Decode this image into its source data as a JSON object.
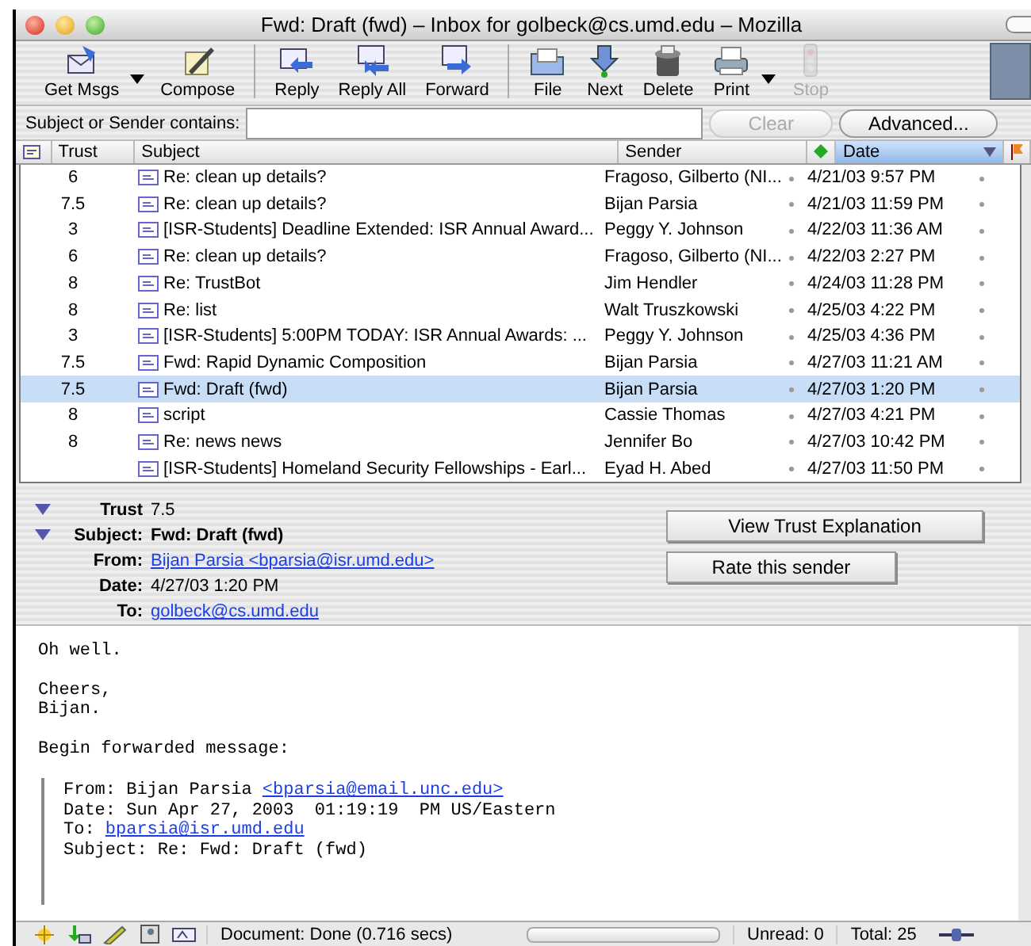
{
  "window": {
    "title": "Fwd: Draft (fwd) – Inbox for golbeck@cs.umd.edu – Mozilla"
  },
  "toolbar": [
    [
      {
        "label": "Get Msgs",
        "kind": "getmsgs",
        "menu": true,
        "disabled": false
      },
      {
        "label": "Compose",
        "kind": "compose",
        "menu": false,
        "disabled": false
      }
    ],
    [
      {
        "label": "Reply",
        "kind": "reply",
        "menu": false,
        "disabled": false
      },
      {
        "label": "Reply All",
        "kind": "replyall",
        "menu": false,
        "disabled": false
      },
      {
        "label": "Forward",
        "kind": "forward",
        "menu": false,
        "disabled": false
      }
    ],
    [
      {
        "label": "File",
        "kind": "file",
        "menu": false,
        "disabled": false
      },
      {
        "label": "Next",
        "kind": "next",
        "menu": false,
        "disabled": false
      },
      {
        "label": "Delete",
        "kind": "delete",
        "menu": false,
        "disabled": false
      },
      {
        "label": "Print",
        "kind": "print",
        "menu": true,
        "disabled": false
      },
      {
        "label": "Stop",
        "kind": "stop",
        "menu": false,
        "disabled": true
      }
    ]
  ],
  "search": {
    "label": "Subject or Sender contains:",
    "clear": {
      "label": "Clear",
      "disabled": true
    },
    "advanced": {
      "label": "Advanced..."
    }
  },
  "columns": {
    "trust": "Trust",
    "subject": "Subject",
    "sender": "Sender",
    "date": "Date"
  },
  "rows": [
    {
      "trust": "6",
      "subject": "Re: clean up details?",
      "sender": "Fragoso, Gilberto (NI...",
      "date": "4/21/03 9:57 PM",
      "selected": false
    },
    {
      "trust": "7.5",
      "subject": "Re: clean up details?",
      "sender": "Bijan Parsia",
      "date": "4/21/03 11:59 PM",
      "selected": false
    },
    {
      "trust": "3",
      "subject": "[ISR-Students] Deadline Extended: ISR Annual Award...",
      "sender": "Peggy Y. Johnson",
      "date": "4/22/03 11:36 AM",
      "selected": false
    },
    {
      "trust": "6",
      "subject": "Re: clean up details?",
      "sender": "Fragoso, Gilberto (NI...",
      "date": "4/22/03 2:27 PM",
      "selected": false
    },
    {
      "trust": "8",
      "subject": "Re: TrustBot",
      "sender": "Jim Hendler",
      "date": "4/24/03 11:28 PM",
      "selected": false
    },
    {
      "trust": "8",
      "subject": "Re: list",
      "sender": "Walt Truszkowski",
      "date": "4/25/03 4:22 PM",
      "selected": false
    },
    {
      "trust": "3",
      "subject": "[ISR-Students] 5:00PM TODAY: ISR Annual Awards: ...",
      "sender": "Peggy Y. Johnson",
      "date": "4/25/03 4:36 PM",
      "selected": false
    },
    {
      "trust": "7.5",
      "subject": "Fwd: Rapid Dynamic Composition",
      "sender": "Bijan Parsia",
      "date": "4/27/03 11:21 AM",
      "selected": false
    },
    {
      "trust": "7.5",
      "subject": "Fwd: Draft (fwd)",
      "sender": "Bijan Parsia",
      "date": "4/27/03 1:20 PM",
      "selected": true
    },
    {
      "trust": "8",
      "subject": "script",
      "sender": "Cassie Thomas",
      "date": "4/27/03 4:21 PM",
      "selected": false
    },
    {
      "trust": "8",
      "subject": "Re: news news",
      "sender": "Jennifer Bo",
      "date": "4/27/03 10:42 PM",
      "selected": false
    },
    {
      "subject": "[ISR-Students] Homeland Security Fellowships - Earl...",
      "sender": "Eyad H. Abed",
      "date": "4/27/03 11:50 PM",
      "selected": false
    }
  ],
  "header": {
    "fields": [
      {
        "label": "Trust",
        "value": "7.5",
        "kind": "text",
        "expanded": true
      },
      {
        "label": "Subject:",
        "value": "Fwd: Draft (fwd)",
        "kind": "bold",
        "expanded": true
      },
      {
        "label": "From:",
        "value": "Bijan Parsia <bparsia@isr.umd.edu>",
        "kind": "link"
      },
      {
        "label": "Date:",
        "value": "4/27/03 1:20 PM",
        "kind": "text"
      },
      {
        "label": "To:",
        "value": "golbeck@cs.umd.edu",
        "kind": "link"
      }
    ],
    "buttons": [
      "View Trust Explanation",
      "Rate this sender"
    ]
  },
  "body": {
    "paragraphs": [
      [
        "Oh well."
      ],
      [
        "Cheers,",
        "Bijan."
      ],
      [
        "Begin forwarded message:"
      ]
    ],
    "quote": [
      {
        "text": "From: Bijan Parsia ",
        "link": "<bparsia@email.unc.edu>"
      },
      {
        "text": "Date: Sun Apr 27, 2003  01:19:19  PM US/Eastern"
      },
      {
        "text": "To: ",
        "link": "bparsia@isr.umd.edu"
      },
      {
        "text": "Subject: Re: Fwd: Draft (fwd)"
      }
    ]
  },
  "status": {
    "message": "Document: Done (0.716 secs)",
    "progress": {
      "level": 0
    },
    "unread": "Unread: 0",
    "total": "Total: 25"
  }
}
